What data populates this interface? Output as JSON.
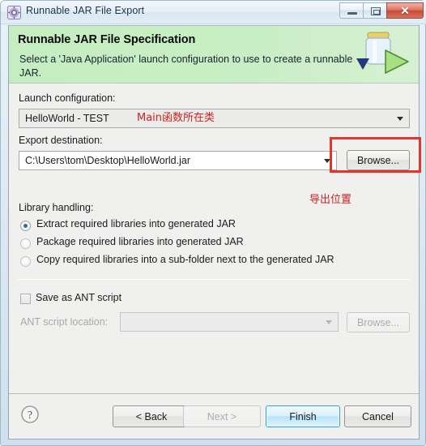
{
  "window": {
    "title": "Runnable JAR File Export",
    "icon": "jar-export-icon",
    "controls": {
      "minimize": "minimize-icon",
      "maximize": "maximize-icon",
      "close": "✕"
    }
  },
  "header": {
    "title": "Runnable JAR File Specification",
    "subtitle": "Select a 'Java Application' launch configuration to use to create a runnable JAR.",
    "icon": "jar-with-arrow-icon",
    "background_color": "#c9eec5"
  },
  "form": {
    "launch_configuration": {
      "label": "Launch configuration:",
      "value": "HelloWorld - TEST",
      "options": [
        "HelloWorld - TEST"
      ]
    },
    "export_destination": {
      "label": "Export destination:",
      "value": "C:\\Users\\tom\\Desktop\\HelloWorld.jar",
      "browse_label": "Browse..."
    },
    "library_handling": {
      "label": "Library handling:",
      "options": [
        {
          "label": "Extract required libraries into generated JAR",
          "selected": true
        },
        {
          "label": "Package required libraries into generated JAR",
          "selected": false
        },
        {
          "label": "Copy required libraries into a sub-folder next to the generated JAR",
          "selected": false
        }
      ]
    },
    "ant": {
      "save_as_ant_label": "Save as ANT script",
      "save_as_ant_checked": false,
      "location_label": "ANT script location:",
      "location_value": "",
      "browse_label": "Browse...",
      "enabled": false
    }
  },
  "footer": {
    "help_icon": "help-icon",
    "buttons": [
      {
        "label": "< Back",
        "state": "enabled"
      },
      {
        "label": "Next >",
        "state": "disabled"
      },
      {
        "label": "Finish",
        "state": "default"
      },
      {
        "label": "Cancel",
        "state": "enabled"
      }
    ]
  },
  "annotations": {
    "color": "#cc2222",
    "launch_config_note": "Main函数所在类",
    "export_destination_note": "导出位置",
    "highlight_box": "browse-button-highlight"
  }
}
